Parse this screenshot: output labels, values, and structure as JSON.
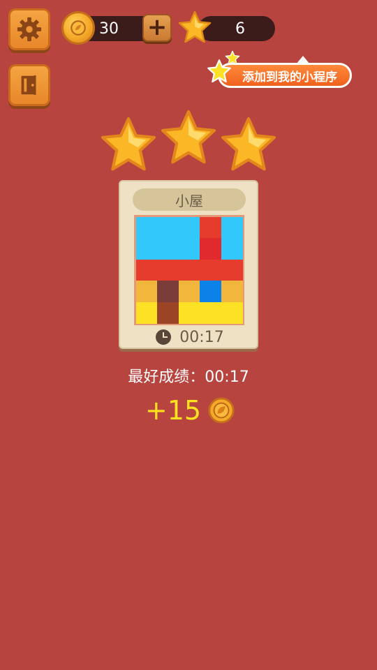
{
  "hud": {
    "coins": "30",
    "stars": "6",
    "add_icon": "plus-icon",
    "settings_icon": "gear-icon",
    "exit_icon": "exit-door-icon"
  },
  "banner": {
    "label": "添加到我的小程序"
  },
  "result": {
    "stars_earned": 3,
    "stars_total": 3,
    "level_name": "小屋",
    "time": "00:17",
    "best_score": "最好成绩：00:17",
    "reward": "+15"
  },
  "puzzle": {
    "rows": 5,
    "cols": 5,
    "cells": [
      [
        "#33c8fb",
        "#33c8fb",
        "#33c8fb",
        "#e63c2e",
        "#33c8fb"
      ],
      [
        "#33c8fb",
        "#33c8fb",
        "#33c8fb",
        "#e02a2e",
        "#33c8fb"
      ],
      [
        "#e63c2e",
        "#e63c2e",
        "#e63c2e",
        "#e63c2e",
        "#e63c2e"
      ],
      [
        "#f2b63c",
        "#7b3d3a",
        "#f2b63c",
        "#0b82e8",
        "#f2b63c"
      ],
      [
        "#fde125",
        "#9b4426",
        "#fde125",
        "#fde125",
        "#fde125"
      ]
    ]
  },
  "colors": {
    "background": "#b84440",
    "accent_gold": "#f6a928",
    "reward_text": "#ffe21f"
  }
}
